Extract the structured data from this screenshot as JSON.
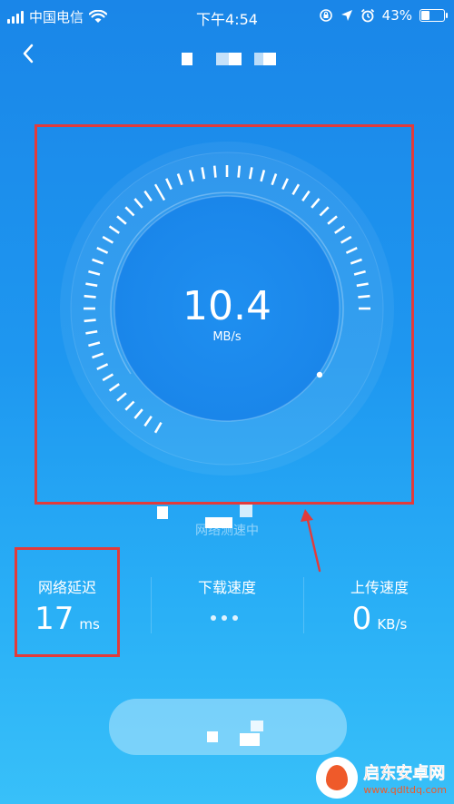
{
  "status_bar": {
    "carrier": "中国电信",
    "time": "下午4:54",
    "battery": "43%",
    "battery_level": 0.43
  },
  "gauge": {
    "speed": "10.4",
    "unit": "MB/s"
  },
  "status_text": "网络测速中",
  "stats": {
    "latency": {
      "label": "网络延迟",
      "value": "17",
      "unit": "ms"
    },
    "download": {
      "label": "下载速度"
    },
    "upload": {
      "label": "上传速度",
      "value": "0",
      "unit": "KB/s"
    }
  },
  "watermark": {
    "brand": "启东安卓网",
    "url": "www.qdltdq.com"
  },
  "colors": {
    "accent": "#1a86e8",
    "highlight": "#e23b3b",
    "watermark": "#ef5a2a"
  }
}
